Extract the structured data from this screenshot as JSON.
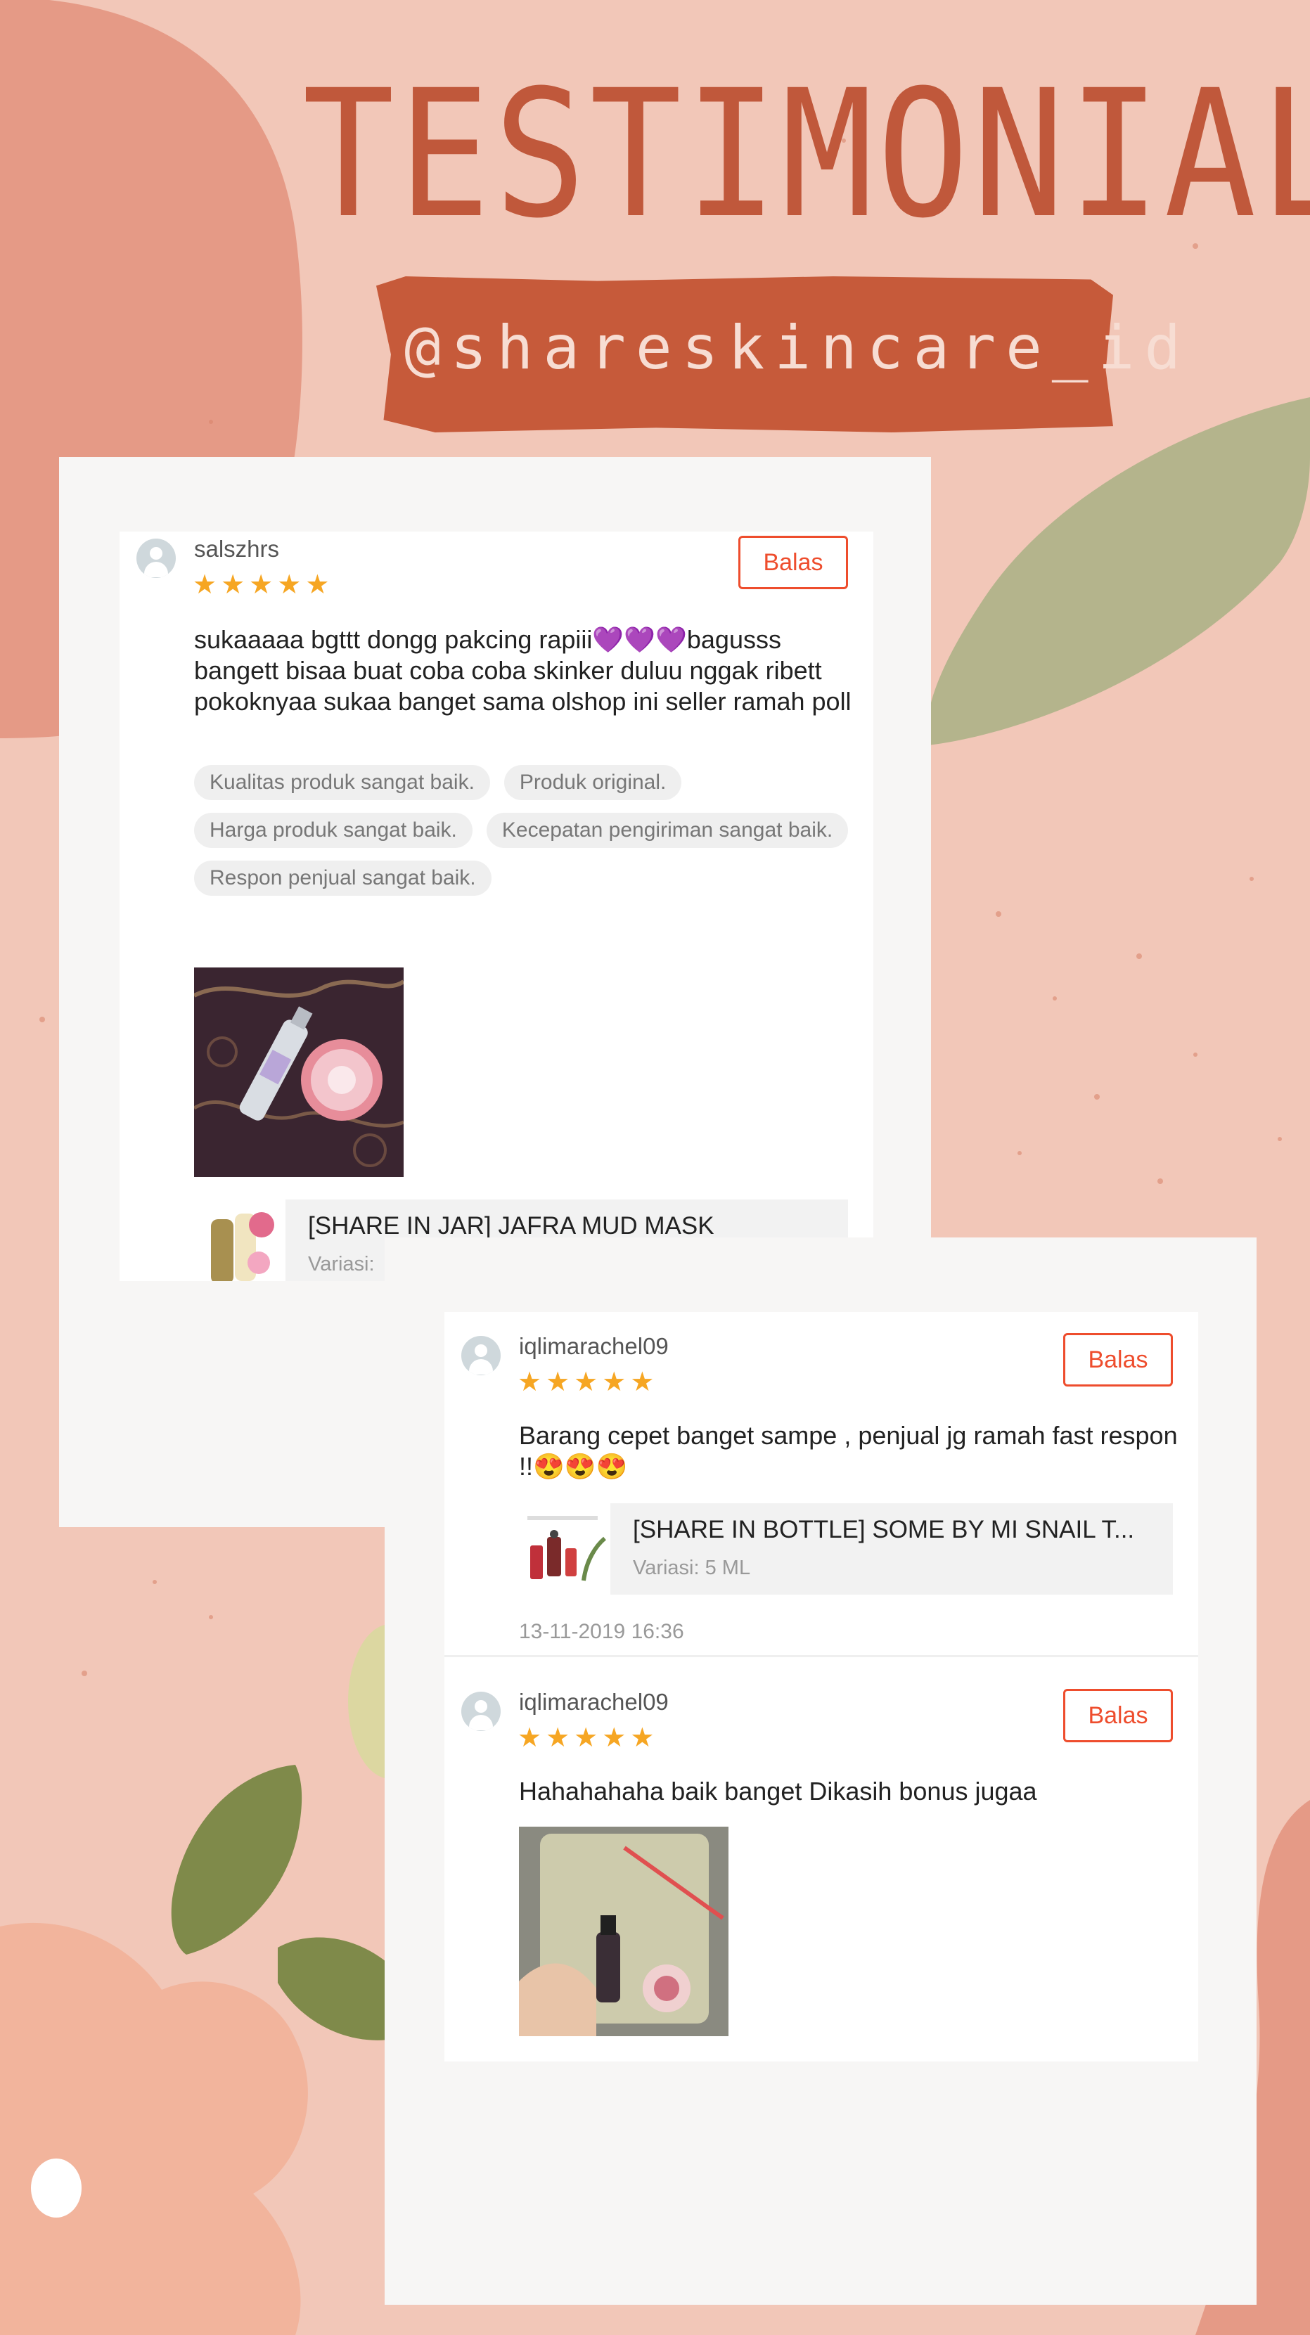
{
  "header": {
    "title": "TESTIMONIAL",
    "handle": "@shareskincare_id"
  },
  "colors": {
    "background": "#f2c7b8",
    "title": "#c0583b",
    "tape": "#c65a3a",
    "leaf_green": "#b4b48c",
    "accent_button": "#ee4d2d",
    "star": "#f6a623"
  },
  "reviews": [
    {
      "username": "salszhrs",
      "rating": 5,
      "reply_label": "Balas",
      "comment": "sukaaaaa bgttt dongg pakcing rapiii💜💜💜bagusss bangett bisaa buat coba coba skinker duluu nggak ribett pokoknyaa sukaa banget sama olshop ini seller ramah poll",
      "tags": [
        "Kualitas produk sangat baik.",
        "Produk original.",
        "Harga produk sangat baik.",
        "Kecepatan pengiriman sangat baik.",
        "Respon penjual sangat baik."
      ],
      "product": {
        "name": "[SHARE IN JAR] JAFRA MUD MASK",
        "variation": "Variasi:"
      }
    },
    {
      "username": "iqlimarachel09",
      "rating": 5,
      "reply_label": "Balas",
      "comment": "Barang cepet banget sampe , penjual jg ramah fast respon !!😍😍😍",
      "product": {
        "name": "[SHARE IN BOTTLE] SOME BY MI SNAIL T...",
        "variation": "Variasi: 5 ML"
      },
      "timestamp": "13-11-2019 16:36"
    },
    {
      "username": "iqlimarachel09",
      "rating": 5,
      "reply_label": "Balas",
      "comment": "Hahahahaha baik banget Dikasih bonus jugaa"
    }
  ]
}
